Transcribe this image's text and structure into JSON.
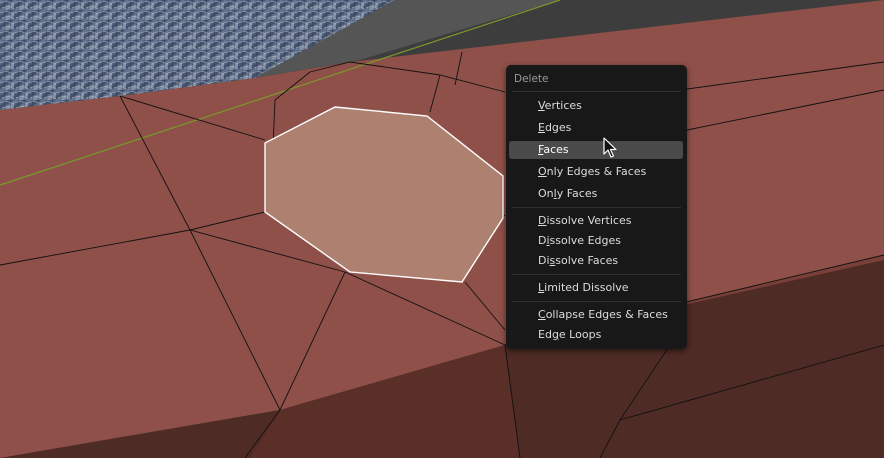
{
  "menu": {
    "title": "Delete",
    "sections": [
      [
        {
          "pre": "",
          "key": "V",
          "post": "ertices",
          "highlighted": false
        },
        {
          "pre": "",
          "key": "E",
          "post": "dges",
          "highlighted": false
        },
        {
          "pre": "",
          "key": "F",
          "post": "aces",
          "highlighted": true
        },
        {
          "pre": "",
          "key": "O",
          "post": "nly Edges & Faces",
          "highlighted": false
        },
        {
          "pre": "On",
          "key": "l",
          "post": "y Faces",
          "highlighted": false
        }
      ],
      [
        {
          "pre": "",
          "key": "D",
          "post": "issolve Vertices",
          "highlighted": false
        },
        {
          "pre": "D",
          "key": "i",
          "post": "ssolve Edges",
          "highlighted": false
        },
        {
          "pre": "Di",
          "key": "s",
          "post": "solve Faces",
          "highlighted": false
        }
      ],
      [
        {
          "pre": "",
          "key": "L",
          "post": "imited Dissolve",
          "highlighted": false
        }
      ],
      [
        {
          "pre": "",
          "key": "C",
          "post": "ollapse Edges & Faces",
          "highlighted": false
        },
        {
          "pre": "Ed",
          "key": "g",
          "post": "e Loops",
          "highlighted": false
        }
      ]
    ]
  },
  "colors": {
    "mesh_face": "#8e5048",
    "mesh_selected": "#ad8070",
    "mesh_shadow": "#4f2b25",
    "menu_bg": "#181818",
    "menu_highlight": "#4a4a4a",
    "viewport_bg": "#3d3d3d",
    "x_axis": "#7a9a2a"
  }
}
